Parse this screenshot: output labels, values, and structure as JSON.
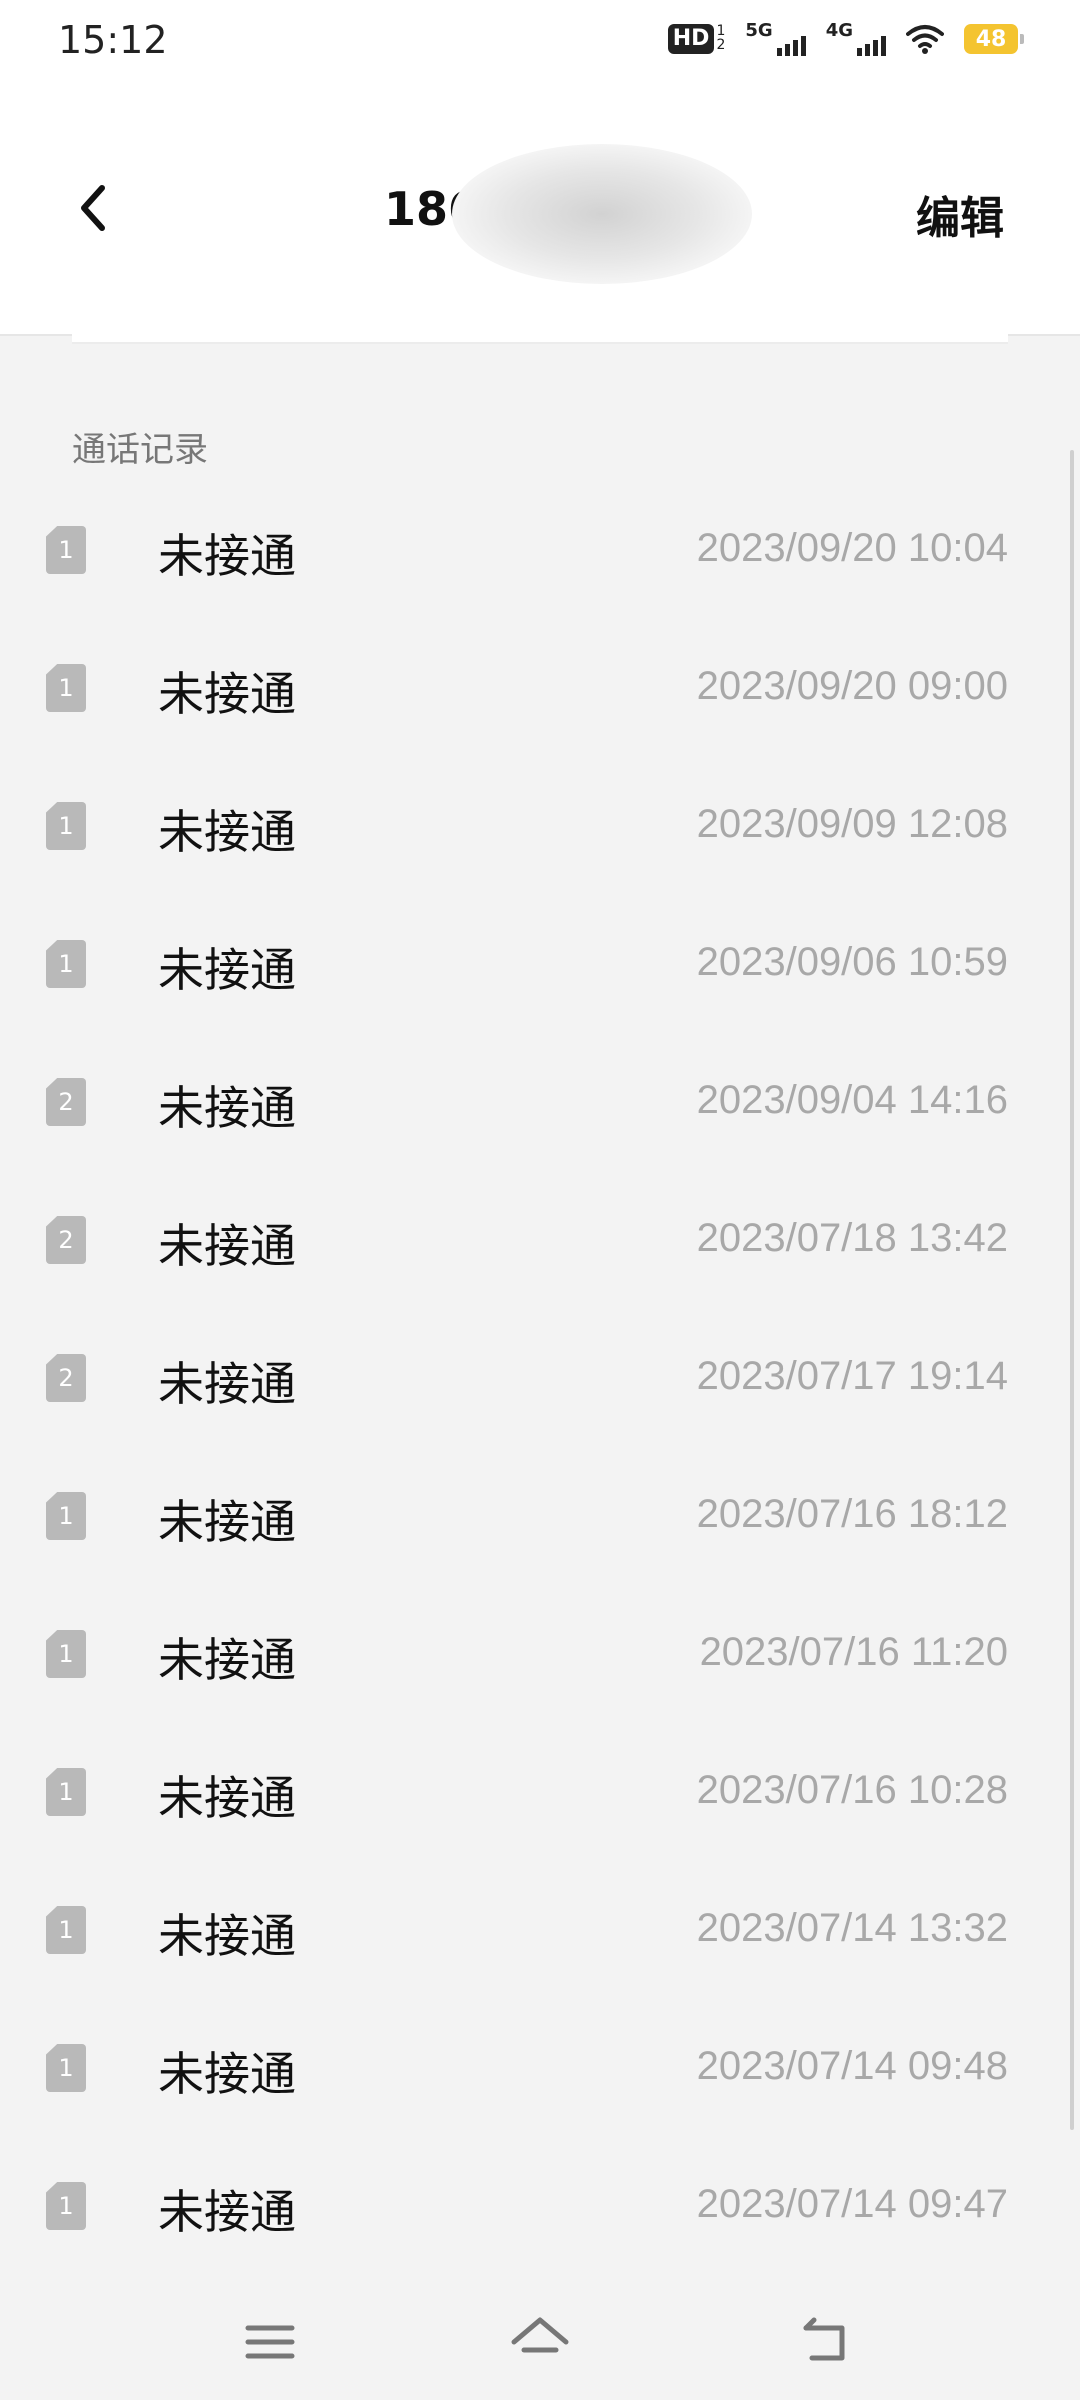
{
  "status_bar": {
    "time": "15:12",
    "hd_label": "HD",
    "hd_sub_top": "1",
    "hd_sub_bottom": "2",
    "net1_label": "5G",
    "net2_label": "4G",
    "battery": "48",
    "icons": [
      "hd-voice-icon",
      "signal-5g-icon",
      "signal-4g-icon",
      "wifi-icon",
      "battery-icon"
    ]
  },
  "header": {
    "title": "186",
    "edit_label": "编辑",
    "back_icon": "chevron-left-icon"
  },
  "section": {
    "title": "通话记录"
  },
  "call_log": [
    {
      "sim": "1",
      "status": "未接通",
      "time": "2023/09/20 10:04"
    },
    {
      "sim": "1",
      "status": "未接通",
      "time": "2023/09/20 09:00"
    },
    {
      "sim": "1",
      "status": "未接通",
      "time": "2023/09/09 12:08"
    },
    {
      "sim": "1",
      "status": "未接通",
      "time": "2023/09/06 10:59"
    },
    {
      "sim": "2",
      "status": "未接通",
      "time": "2023/09/04 14:16"
    },
    {
      "sim": "2",
      "status": "未接通",
      "time": "2023/07/18 13:42"
    },
    {
      "sim": "2",
      "status": "未接通",
      "time": "2023/07/17 19:14"
    },
    {
      "sim": "1",
      "status": "未接通",
      "time": "2023/07/16 18:12"
    },
    {
      "sim": "1",
      "status": "未接通",
      "time": "2023/07/16 11:20"
    },
    {
      "sim": "1",
      "status": "未接通",
      "time": "2023/07/16 10:28"
    },
    {
      "sim": "1",
      "status": "未接通",
      "time": "2023/07/14 13:32"
    },
    {
      "sim": "1",
      "status": "未接通",
      "time": "2023/07/14 09:48"
    },
    {
      "sim": "1",
      "status": "未接通",
      "time": "2023/07/14 09:47"
    }
  ],
  "nav_bar": {
    "icons": [
      "menu-icon",
      "home-icon",
      "back-icon"
    ]
  },
  "colors": {
    "background": "#f3f3f3",
    "surface": "#ffffff",
    "sim_badge": "#b9b9b9",
    "timestamp": "#a8a8a8",
    "battery": "#f4c430"
  }
}
